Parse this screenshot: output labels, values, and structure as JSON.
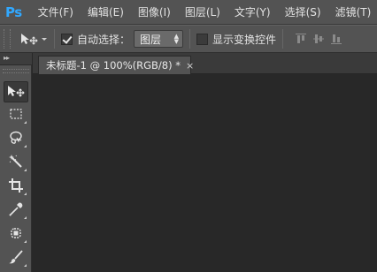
{
  "app": {
    "logo_text": "Ps"
  },
  "menu": {
    "items": [
      {
        "label": "文件(F)"
      },
      {
        "label": "编辑(E)"
      },
      {
        "label": "图像(I)"
      },
      {
        "label": "图层(L)"
      },
      {
        "label": "文字(Y)"
      },
      {
        "label": "选择(S)"
      },
      {
        "label": "滤镜(T)"
      }
    ]
  },
  "options_bar": {
    "auto_select": {
      "label": "自动选择：",
      "checked": true
    },
    "auto_select_target": {
      "value": "图层"
    },
    "show_transform": {
      "label": "显示变换控件",
      "checked": false
    }
  },
  "tools": [
    {
      "name": "move-tool",
      "icon": "move-icon",
      "active": true
    },
    {
      "name": "marquee-tool",
      "icon": "rect-marquee-icon"
    },
    {
      "name": "lasso-tool",
      "icon": "lasso-icon"
    },
    {
      "name": "magic-wand-tool",
      "icon": "magic-wand-icon"
    },
    {
      "name": "crop-tool",
      "icon": "crop-icon"
    },
    {
      "name": "eyedropper-tool",
      "icon": "eyedropper-icon"
    },
    {
      "name": "healing-tool",
      "icon": "healing-brush-icon"
    },
    {
      "name": "brush-tool",
      "icon": "brush-icon"
    }
  ],
  "document": {
    "tab_title": "未标题-1 @ 100%(RGB/8) *",
    "close_glyph": "×"
  },
  "colors": {
    "accent": "#31a8ff",
    "panel": "#535353",
    "canvas_bg": "#282828"
  }
}
